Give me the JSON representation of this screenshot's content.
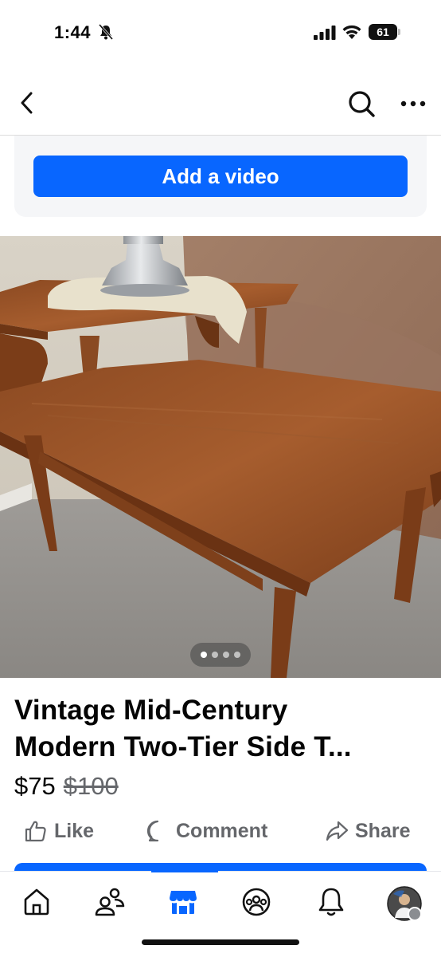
{
  "status_bar": {
    "time": "1:44",
    "battery": "61"
  },
  "nav": {
    "back_icon": "chevron-left-icon",
    "search_icon": "search-icon",
    "more_icon": "more-horizontal-icon"
  },
  "video_card": {
    "add_video_label": "Add a video"
  },
  "carousel": {
    "total_images": 4,
    "active_index": 0
  },
  "listing": {
    "title_line1": "Vintage Mid-Century",
    "title_line2": "Modern Two-Tier Side T...",
    "price": "$75",
    "original_price": "$100"
  },
  "actions": {
    "like": "Like",
    "comment": "Comment",
    "share": "Share"
  },
  "tab_bar": {
    "tabs": [
      "home-icon",
      "friends-icon",
      "marketplace-icon",
      "groups-icon",
      "notifications-icon",
      "profile-avatar"
    ],
    "active_tab": "marketplace-icon"
  },
  "colors": {
    "accent": "#0866ff",
    "secondary_text": "#65676b"
  }
}
